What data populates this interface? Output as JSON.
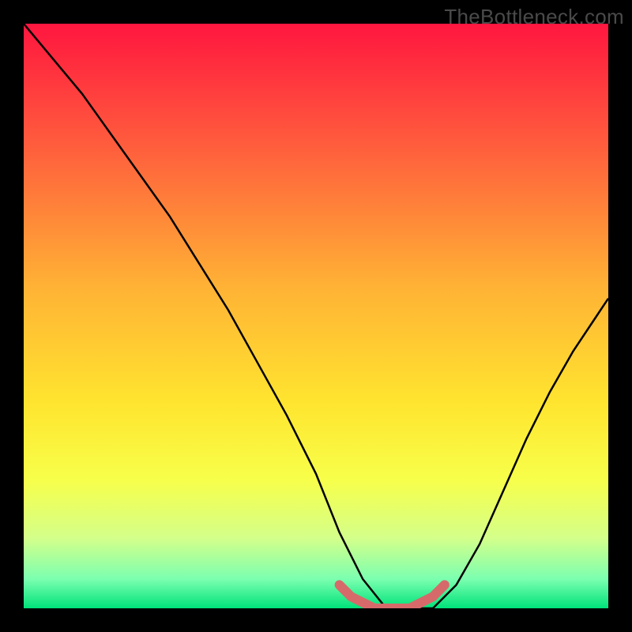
{
  "watermark": "TheBottleneck.com",
  "chart_data": {
    "type": "line",
    "title": "",
    "xlabel": "",
    "ylabel": "",
    "xlim": [
      0,
      100
    ],
    "ylim": [
      0,
      100
    ],
    "gradient_stops": [
      {
        "offset": 0,
        "color": "#ff163f"
      },
      {
        "offset": 20,
        "color": "#ff5a3d"
      },
      {
        "offset": 45,
        "color": "#ffb235"
      },
      {
        "offset": 65,
        "color": "#ffe52f"
      },
      {
        "offset": 78,
        "color": "#f7ff4a"
      },
      {
        "offset": 88,
        "color": "#d4ff8a"
      },
      {
        "offset": 95,
        "color": "#7bffb0"
      },
      {
        "offset": 100,
        "color": "#00e27a"
      }
    ],
    "series": [
      {
        "name": "bottleneck-curve",
        "x": [
          0,
          5,
          10,
          15,
          20,
          25,
          30,
          35,
          40,
          45,
          50,
          54,
          58,
          62,
          66,
          70,
          74,
          78,
          82,
          86,
          90,
          94,
          98,
          100
        ],
        "y": [
          100,
          94,
          88,
          81,
          74,
          67,
          59,
          51,
          42,
          33,
          23,
          13,
          5,
          0,
          0,
          0,
          4,
          11,
          20,
          29,
          37,
          44,
          50,
          53
        ]
      }
    ],
    "highlight": {
      "name": "optimal-range",
      "color": "#d66a6a",
      "x": [
        54,
        56,
        58,
        60,
        62,
        64,
        66,
        68,
        70,
        72
      ],
      "y": [
        4,
        2,
        1,
        0,
        0,
        0,
        0,
        1,
        2,
        4
      ]
    }
  }
}
